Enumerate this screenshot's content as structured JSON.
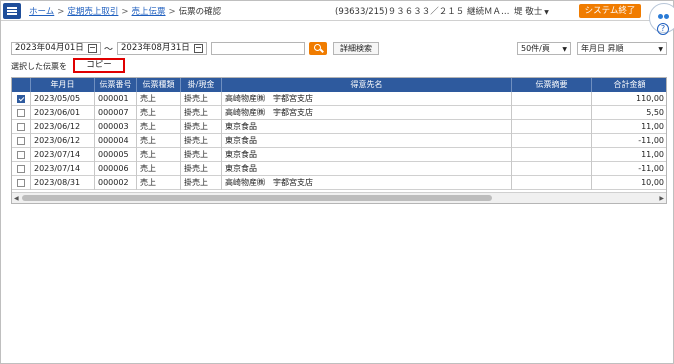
{
  "breadcrumb": {
    "items": [
      "ホーム",
      "定期売上取引",
      "売上伝票"
    ],
    "current": "伝票の確認",
    "separator": ">"
  },
  "header": {
    "company": "(93633/215)９３６３３／２１５ 継続ＭＡ…",
    "user": "堤 敬士",
    "system_exit_label": "システム終了"
  },
  "toolbar": {
    "date_from": "2023年04月01日",
    "date_to": "2023年08月31日",
    "tilde": "～",
    "keyword_value": "",
    "detail_search_label": "詳細検索",
    "page_size": "50件/頁",
    "sort_order": "年月日 昇順"
  },
  "selection": {
    "label": "選択した伝票を",
    "copy_label": "コピー"
  },
  "table": {
    "columns": [
      "",
      "年月日",
      "伝票番号",
      "伝票種類",
      "掛/現金",
      "得意先名",
      "伝票摘要",
      "合計金額"
    ],
    "rows": [
      {
        "checked": true,
        "date": "2023/05/05",
        "no": "000001",
        "type": "売上",
        "pay": "掛売上",
        "customer": "高崎物産㈱　宇都宮支店",
        "memo": "",
        "amount": "110,00"
      },
      {
        "checked": false,
        "date": "2023/06/01",
        "no": "000007",
        "type": "売上",
        "pay": "掛売上",
        "customer": "高崎物産㈱　宇都宮支店",
        "memo": "",
        "amount": "5,50"
      },
      {
        "checked": false,
        "date": "2023/06/12",
        "no": "000003",
        "type": "売上",
        "pay": "掛売上",
        "customer": "東京食品",
        "memo": "",
        "amount": "11,00"
      },
      {
        "checked": false,
        "date": "2023/06/12",
        "no": "000004",
        "type": "売上",
        "pay": "掛売上",
        "customer": "東京食品",
        "memo": "",
        "amount": "-11,00"
      },
      {
        "checked": false,
        "date": "2023/07/14",
        "no": "000005",
        "type": "売上",
        "pay": "掛売上",
        "customer": "東京食品",
        "memo": "",
        "amount": "11,00"
      },
      {
        "checked": false,
        "date": "2023/07/14",
        "no": "000006",
        "type": "売上",
        "pay": "掛売上",
        "customer": "東京食品",
        "memo": "",
        "amount": "-11,00"
      },
      {
        "checked": false,
        "date": "2023/08/31",
        "no": "000002",
        "type": "売上",
        "pay": "掛売上",
        "customer": "高崎物産㈱　宇都宮支店",
        "memo": "",
        "amount": "10,00"
      }
    ]
  },
  "colors": {
    "header_blue": "#2e5a9e",
    "accent_orange": "#f07c00",
    "link": "#1f5fbf",
    "copy_outline": "#e00000"
  },
  "icons": {
    "menu": "hamburger-icon",
    "calendar": "calendar-icon",
    "search": "search-icon",
    "help": "help-icon"
  }
}
